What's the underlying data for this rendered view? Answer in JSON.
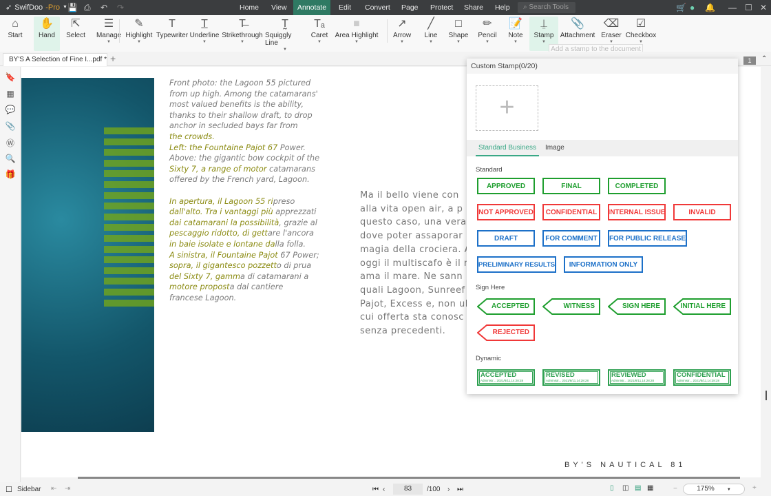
{
  "app": {
    "name": "SwifDoo",
    "edition": "-Pro"
  },
  "menu": [
    "Home",
    "View",
    "Annotate",
    "Edit",
    "Convert",
    "Page",
    "Protect",
    "Share",
    "Help"
  ],
  "menu_active": "Annotate",
  "search": {
    "placeholder": "Search Tools"
  },
  "tools": [
    {
      "label": "Start",
      "icon": "home-icon",
      "caret": false
    },
    {
      "label": "Hand",
      "icon": "hand-icon",
      "caret": false,
      "active": true
    },
    {
      "label": "Select",
      "icon": "cursor-icon",
      "caret": false
    },
    {
      "label": "Manage",
      "icon": "manage-icon",
      "caret": true
    },
    {
      "label": "Highlight",
      "icon": "highlighter-icon",
      "caret": true
    },
    {
      "label": "Typewriter",
      "icon": "typewriter-icon",
      "caret": false
    },
    {
      "label": "Underline",
      "icon": "underline-icon",
      "caret": true
    },
    {
      "label": "Strikethrough",
      "icon": "strikethrough-icon",
      "caret": true
    },
    {
      "label": "Squiggly Line",
      "icon": "squiggly-icon",
      "caret": true
    },
    {
      "label": "Caret",
      "icon": "caret-icon",
      "caret": true
    },
    {
      "label": "Area Highlight",
      "icon": "area-highlight-icon",
      "caret": true
    },
    {
      "label": "Arrow",
      "icon": "arrow-icon",
      "caret": true
    },
    {
      "label": "Line",
      "icon": "line-icon",
      "caret": true
    },
    {
      "label": "Shape",
      "icon": "shape-icon",
      "caret": true
    },
    {
      "label": "Pencil",
      "icon": "pencil-icon",
      "caret": true
    },
    {
      "label": "Note",
      "icon": "note-icon",
      "caret": true
    },
    {
      "label": "Stamp",
      "icon": "stamp-icon",
      "caret": true,
      "active": true
    },
    {
      "label": "Attachment",
      "icon": "paperclip-icon",
      "caret": false
    },
    {
      "label": "Eraser",
      "icon": "eraser-icon",
      "caret": true
    },
    {
      "label": "Checkbox",
      "icon": "checkbox-icon",
      "caret": true
    }
  ],
  "tooltip": "Add a stamp to the document",
  "tab": {
    "title": "BY'S A Selection of Fine I...pdf *"
  },
  "document": {
    "caption": [
      [
        [
          "Front photo: the Lagoon 55 pictured",
          0
        ]
      ],
      [
        [
          "from up high. Among the catamarans'",
          0
        ]
      ],
      [
        [
          "most valued benefits is the ability,",
          0
        ]
      ],
      [
        [
          "thanks to their shallow draft, to drop",
          0
        ]
      ],
      [
        [
          "anchor in secluded bays far from",
          0
        ]
      ],
      [
        [
          "the crowds.",
          1
        ]
      ],
      [
        [
          "Left: the Fountaine Pajot 67",
          1
        ],
        [
          " Power.",
          0
        ]
      ],
      [
        [
          "Above: the gigantic bow cockpit of the",
          0
        ]
      ],
      [
        [
          "Sixty 7, a range of motor",
          1
        ],
        [
          " catamarans",
          0
        ]
      ],
      [
        [
          "offered by the French yard, Lagoon.",
          0
        ]
      ],
      [
        [
          "",
          0
        ]
      ],
      [
        [
          "In apertura, il Lagoon 55 ri",
          1
        ],
        [
          "preso",
          0
        ]
      ],
      [
        [
          "dall'alto. Tra i vantaggi più",
          1
        ],
        [
          " apprezzati",
          0
        ]
      ],
      [
        [
          "dai catamarani la possibilità",
          1
        ],
        [
          ", grazie al",
          0
        ]
      ],
      [
        [
          "pescaggio ridotto, di gett",
          1
        ],
        [
          "are l'ancora",
          0
        ]
      ],
      [
        [
          "in baie isolate e lontane da",
          1
        ],
        [
          "lla folla.",
          0
        ]
      ],
      [
        [
          "A sinistra, il Fountaine Pajot",
          1
        ],
        [
          " 67 Power;",
          0
        ]
      ],
      [
        [
          "sopra, il gigantesco pozzett",
          1
        ],
        [
          "o di prua",
          0
        ]
      ],
      [
        [
          "del Sixty 7, gamm",
          1
        ],
        [
          "a di catamarani a",
          0
        ]
      ],
      [
        [
          "motore propost",
          1
        ],
        [
          "a dal cantiere",
          0
        ]
      ],
      [
        [
          "francese Lagoon.",
          0
        ]
      ]
    ],
    "body": [
      "Ma il bello viene con",
      "alla vita open air, a p",
      "questo caso, una vera",
      "dove poter assaporar",
      "magia della crociera. A",
      "oggi il multiscafo è il n",
      "ama il mare. Ne sann",
      "quali Lagoon, Sunreef",
      "Pajot, Excess e, non ul",
      "cui offerta sta conosc",
      "senza precedenti."
    ],
    "footer": "BY'S NAUTICAL 81",
    "page_badge": "1"
  },
  "stamp_panel": {
    "title": "Custom Stamp(0/20)",
    "tabs": [
      "Standard Business",
      "Image"
    ],
    "active_tab": "Standard Business",
    "sections": {
      "standard": "Standard",
      "sign": "Sign Here",
      "dynamic": "Dynamic"
    },
    "standard": [
      [
        {
          "label": "APPROVED",
          "color": "g"
        },
        {
          "label": "FINAL",
          "color": "g"
        },
        {
          "label": "COMPLETED",
          "color": "g"
        }
      ],
      [
        {
          "label": "NOT APPROVED",
          "color": "r"
        },
        {
          "label": "CONFIDENTIAL",
          "color": "r"
        },
        {
          "label": "INTERNAL ISSUE",
          "color": "r"
        },
        {
          "label": "INVALID",
          "color": "r"
        }
      ],
      [
        {
          "label": "DRAFT",
          "color": "b"
        },
        {
          "label": "FOR COMMENT",
          "color": "b"
        },
        {
          "label": "FOR PUBLIC RELEASE",
          "color": "b"
        }
      ],
      [
        {
          "label": "PRELIMINARY RESULTS",
          "color": "b"
        },
        {
          "label": "INFORMATION ONLY",
          "color": "b"
        }
      ]
    ],
    "sign_here": [
      [
        {
          "label": "ACCEPTED",
          "color": "#1e9e2e"
        },
        {
          "label": "WITNESS",
          "color": "#1e9e2e"
        },
        {
          "label": "SIGN HERE",
          "color": "#1e9e2e"
        },
        {
          "label": "INITIAL HERE",
          "color": "#1e9e2e"
        }
      ],
      [
        {
          "label": "REJECTED",
          "color": "#f03838"
        }
      ]
    ],
    "dynamic": [
      {
        "label": "ACCEPTED",
        "sub": "Administr...  2021/8/11,14:28:28"
      },
      {
        "label": "REVISED",
        "sub": "Administr...  2021/8/11,14:28:28"
      },
      {
        "label": "REVIEWED",
        "sub": "Administr...  2021/8/11,14:28:28"
      },
      {
        "label": "CONFIDENTIAL",
        "sub": "Administr...  2021/8/11,14:28:28"
      }
    ]
  },
  "statusbar": {
    "sidebar": "Sidebar",
    "page": "83",
    "total": "/100",
    "zoom": "175%"
  },
  "colors": {
    "accent": "#2f7a63",
    "green": "#1e9e2e",
    "red": "#f03838",
    "blue": "#1c70c8"
  }
}
